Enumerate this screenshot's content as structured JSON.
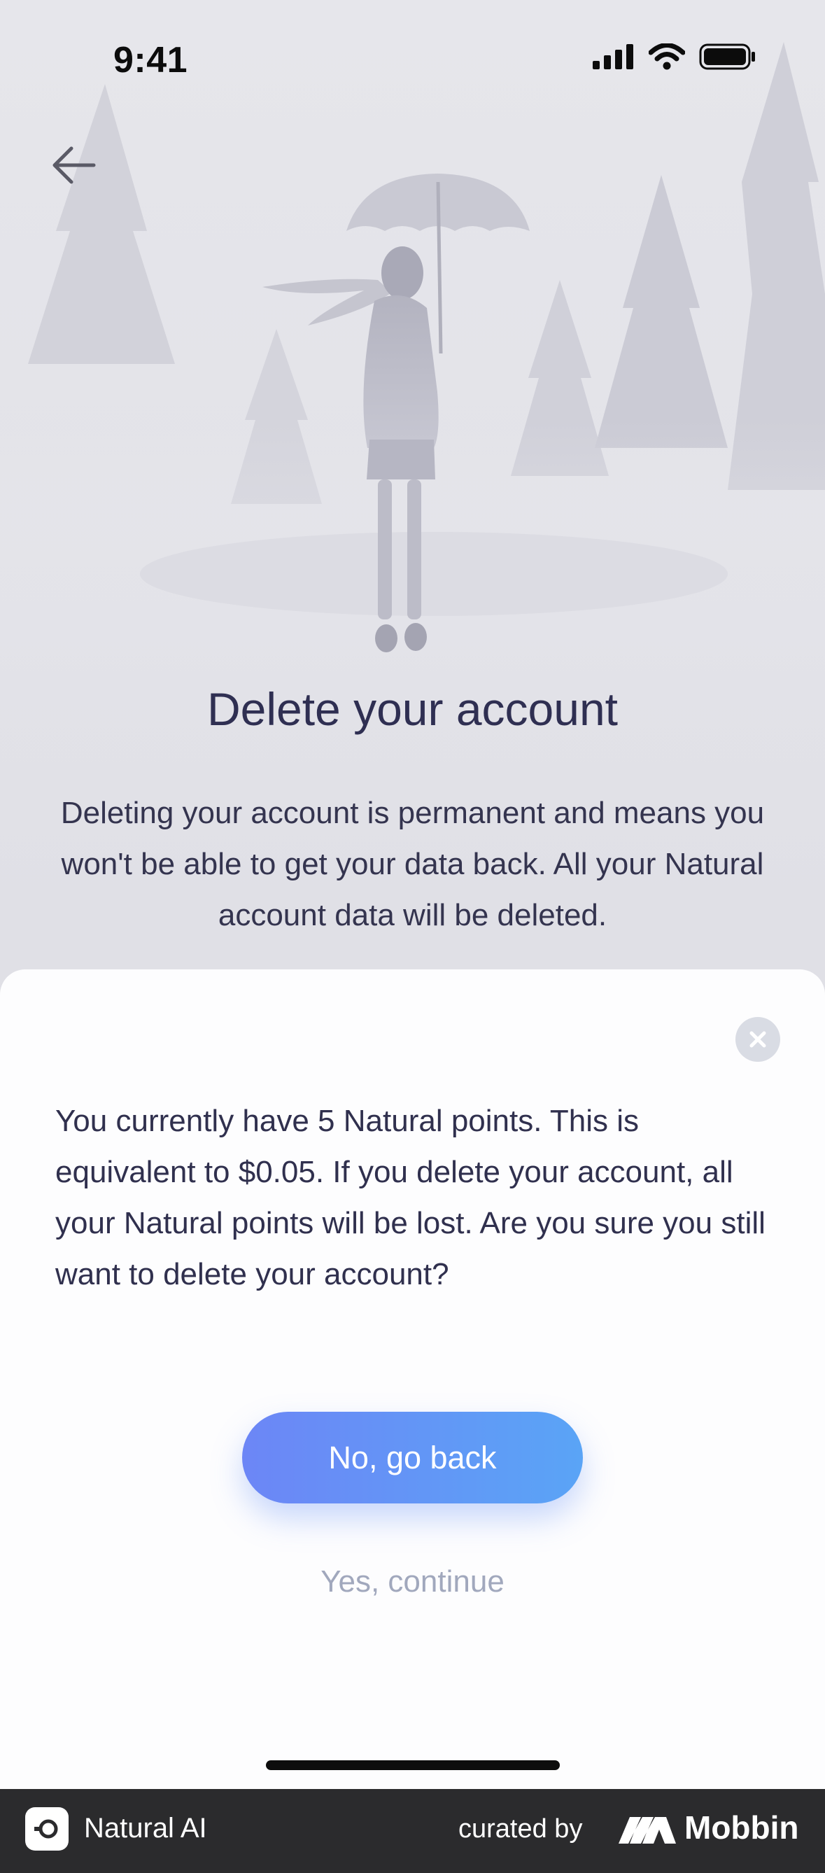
{
  "status_bar": {
    "time": "9:41"
  },
  "hero": {
    "title": "Delete your account",
    "description": "Deleting your account is permanent and means you won't be able to get your data back. All your Natural account data will be deleted."
  },
  "sheet": {
    "message": "You currently have 5 Natural points. This is equivalent to $0.05. If you delete your account, all your Natural points will be lost. Are you sure you still want to delete your account?",
    "primary_label": "No, go back",
    "secondary_label": "Yes, continue"
  },
  "footer": {
    "app_name": "Natural AI",
    "curated_by": "curated by",
    "brand": "Mobbin"
  },
  "colors": {
    "accent_start": "#6c86f6",
    "accent_end": "#5aa4f6",
    "title_text": "#2f2f52",
    "muted_text": "#a1a8bd"
  }
}
